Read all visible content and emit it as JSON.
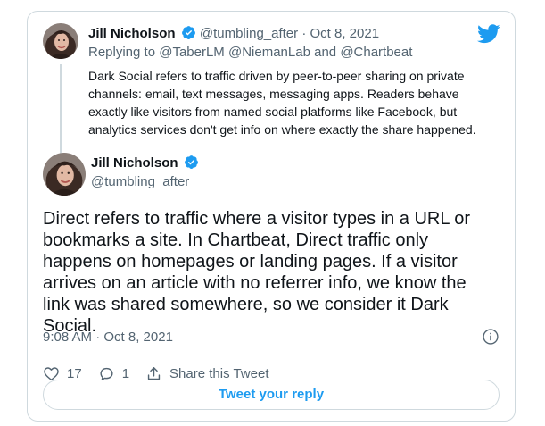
{
  "parent_tweet": {
    "author_name": "Jill Nicholson",
    "handle": "@tumbling_after",
    "separator": "·",
    "date": "Oct 8, 2021",
    "replying_prefix": "Replying to",
    "reply_targets": [
      "@TaberLM",
      "@NiemanLab",
      "@Chartbeat"
    ],
    "reply_joiner": "and",
    "text": "Dark Social refers to traffic driven by peer-to-peer sharing on private channels: email, text messages, messaging apps. Readers behave exactly like visitors from named social platforms like Facebook, but analytics services don't get info on where exactly the share happened."
  },
  "main_tweet": {
    "author_name": "Jill Nicholson",
    "handle": "@tumbling_after",
    "text": "Direct refers to traffic where a visitor types in a URL or bookmarks a site. In Chartbeat, Direct traffic only happens on homepages or landing pages. If a visitor arrives on an article with no referrer info, we know the link was shared somewhere, so we consider it Dark Social.",
    "timestamp": "9:08 AM · Oct 8, 2021"
  },
  "actions": {
    "like_count": "17",
    "reply_count": "1",
    "share_label": "Share this Tweet"
  },
  "reply_button_label": "Tweet your reply",
  "icons": {
    "logo": "twitter-bird-icon",
    "verified": "verified-badge-icon",
    "info": "info-icon",
    "like": "heart-icon",
    "reply": "reply-bubble-icon",
    "share": "share-icon"
  },
  "colors": {
    "accent": "#1d9bf0",
    "muted": "#536471",
    "border": "#cfd9de"
  }
}
